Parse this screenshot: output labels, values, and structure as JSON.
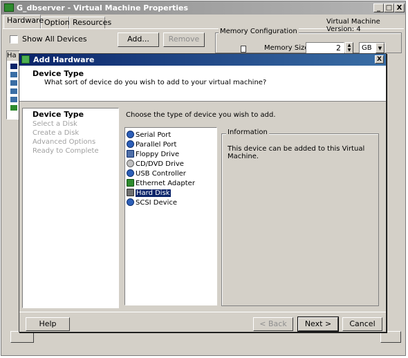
{
  "main_window": {
    "title": "G_dbserver - Virtual Machine Properties",
    "caption_minimize": "_",
    "caption_maximize": "□",
    "caption_close": "X",
    "tabs": [
      {
        "label": "Hardware",
        "active": true
      },
      {
        "label": "Options",
        "active": false
      },
      {
        "label": "Resources",
        "active": false
      }
    ],
    "vm_version": "Virtual Machine Version: 4",
    "show_all_devices_label": "Show All Devices",
    "show_all_devices_checked": false,
    "add_button": "Add...",
    "remove_button": "Remove",
    "hardware_column_stub": "Ha",
    "memory_group_label": "Memory Configuration",
    "memory_size_label": "Memory Size:",
    "memory_size_value": "2",
    "memory_unit": "GB"
  },
  "add_hardware": {
    "title": "Add Hardware",
    "close_label": "X",
    "header_title": "Device Type",
    "header_subtitle": "What sort of device do you wish to add to your virtual machine?",
    "steps": [
      {
        "label": "Device Type",
        "current": true
      },
      {
        "label": "Select a Disk",
        "current": false
      },
      {
        "label": "Create a Disk",
        "current": false
      },
      {
        "label": "Advanced Options",
        "current": false
      },
      {
        "label": "Ready to Complete",
        "current": false
      }
    ],
    "instruction": "Choose the type of device you wish to add.",
    "devices": [
      {
        "label": "Serial Port",
        "icon": "serial-port-icon",
        "selected": false
      },
      {
        "label": "Parallel Port",
        "icon": "parallel-port-icon",
        "selected": false
      },
      {
        "label": "Floppy Drive",
        "icon": "floppy-drive-icon",
        "selected": false
      },
      {
        "label": "CD/DVD Drive",
        "icon": "cd-dvd-drive-icon",
        "selected": false
      },
      {
        "label": "USB Controller",
        "icon": "usb-controller-icon",
        "selected": false
      },
      {
        "label": "Ethernet Adapter",
        "icon": "ethernet-adapter-icon",
        "selected": false
      },
      {
        "label": "Hard Disk",
        "icon": "hard-disk-icon",
        "selected": true
      },
      {
        "label": "SCSI Device",
        "icon": "scsi-device-icon",
        "selected": false
      }
    ],
    "information_legend": "Information",
    "information_text": "This device can be added to this Virtual Machine.",
    "buttons": {
      "help": "Help",
      "back": "< Back",
      "next": "Next >",
      "cancel": "Cancel"
    }
  },
  "colors": {
    "dialog_title_active": "#0a246a",
    "window_title_inactive": "#8c8c8c",
    "face": "#d4d0c8",
    "selection": "#0a246a"
  }
}
